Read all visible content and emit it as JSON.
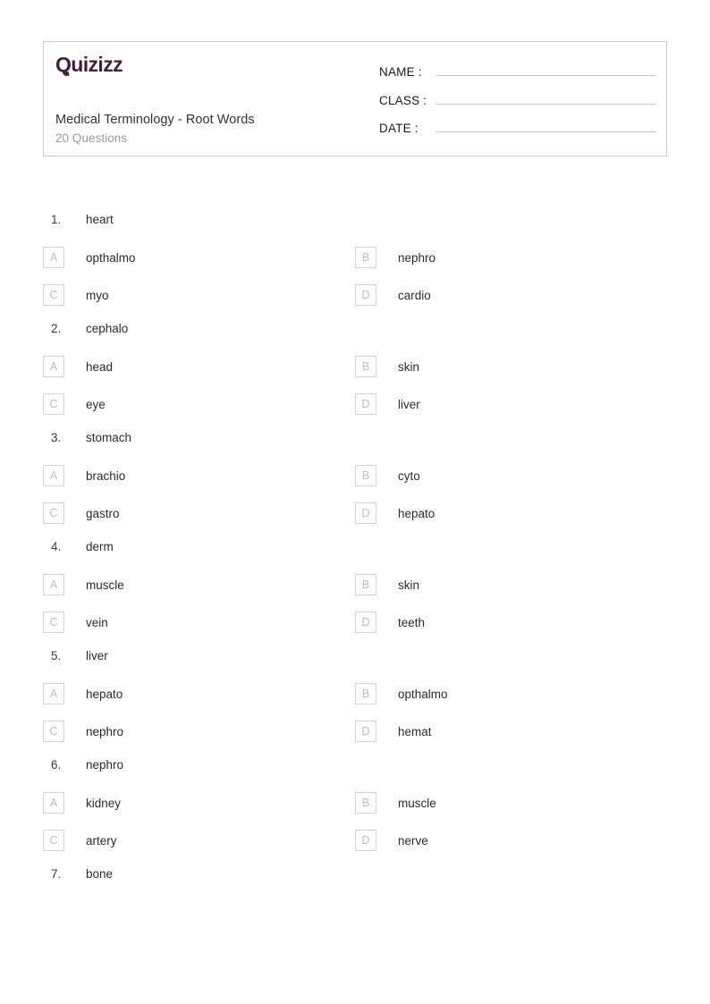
{
  "brand": {
    "logo_text": "Quizizz",
    "logo_color": "#3f1f3c"
  },
  "header": {
    "quiz_title": "Medical Terminology - Root Words",
    "question_count_label": "20 Questions",
    "fields": [
      {
        "label": "NAME :",
        "value": ""
      },
      {
        "label": "CLASS :",
        "value": ""
      },
      {
        "label": "DATE  :",
        "value": ""
      }
    ]
  },
  "questions": [
    {
      "number": "1.",
      "prompt": "heart",
      "options": [
        {
          "letter": "A",
          "text": "opthalmo"
        },
        {
          "letter": "B",
          "text": "nephro"
        },
        {
          "letter": "C",
          "text": "myo"
        },
        {
          "letter": "D",
          "text": "cardio"
        }
      ]
    },
    {
      "number": "2.",
      "prompt": "cephalo",
      "options": [
        {
          "letter": "A",
          "text": "head"
        },
        {
          "letter": "B",
          "text": "skin"
        },
        {
          "letter": "C",
          "text": "eye"
        },
        {
          "letter": "D",
          "text": "liver"
        }
      ]
    },
    {
      "number": "3.",
      "prompt": "stomach",
      "options": [
        {
          "letter": "A",
          "text": "brachio"
        },
        {
          "letter": "B",
          "text": "cyto"
        },
        {
          "letter": "C",
          "text": "gastro"
        },
        {
          "letter": "D",
          "text": "hepato"
        }
      ]
    },
    {
      "number": "4.",
      "prompt": "derm",
      "options": [
        {
          "letter": "A",
          "text": "muscle"
        },
        {
          "letter": "B",
          "text": "skin"
        },
        {
          "letter": "C",
          "text": "vein"
        },
        {
          "letter": "D",
          "text": "teeth"
        }
      ]
    },
    {
      "number": "5.",
      "prompt": "liver",
      "options": [
        {
          "letter": "A",
          "text": "hepato"
        },
        {
          "letter": "B",
          "text": "opthalmo"
        },
        {
          "letter": "C",
          "text": "nephro"
        },
        {
          "letter": "D",
          "text": "hemat"
        }
      ]
    },
    {
      "number": "6.",
      "prompt": "nephro",
      "options": [
        {
          "letter": "A",
          "text": "kidney"
        },
        {
          "letter": "B",
          "text": "muscle"
        },
        {
          "letter": "C",
          "text": "artery"
        },
        {
          "letter": "D",
          "text": "nerve"
        }
      ]
    },
    {
      "number": "7.",
      "prompt": "bone",
      "options": []
    }
  ]
}
